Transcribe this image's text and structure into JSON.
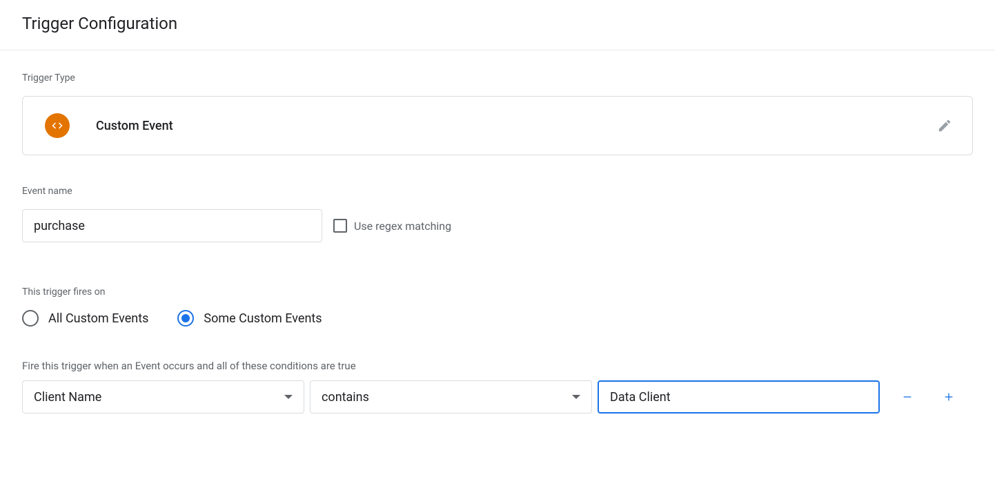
{
  "header": {
    "title": "Trigger Configuration"
  },
  "trigger_type": {
    "label": "Trigger Type",
    "name": "Custom Event"
  },
  "event_name": {
    "label": "Event name",
    "value": "purchase",
    "regex_label": "Use regex matching"
  },
  "fires_on": {
    "label": "This trigger fires on",
    "options": [
      {
        "label": "All Custom Events",
        "selected": false
      },
      {
        "label": "Some Custom Events",
        "selected": true
      }
    ]
  },
  "conditions": {
    "help": "Fire this trigger when an Event occurs and all of these conditions are true",
    "rows": [
      {
        "variable": "Client Name",
        "operator": "contains",
        "value": "Data Client"
      }
    ]
  }
}
